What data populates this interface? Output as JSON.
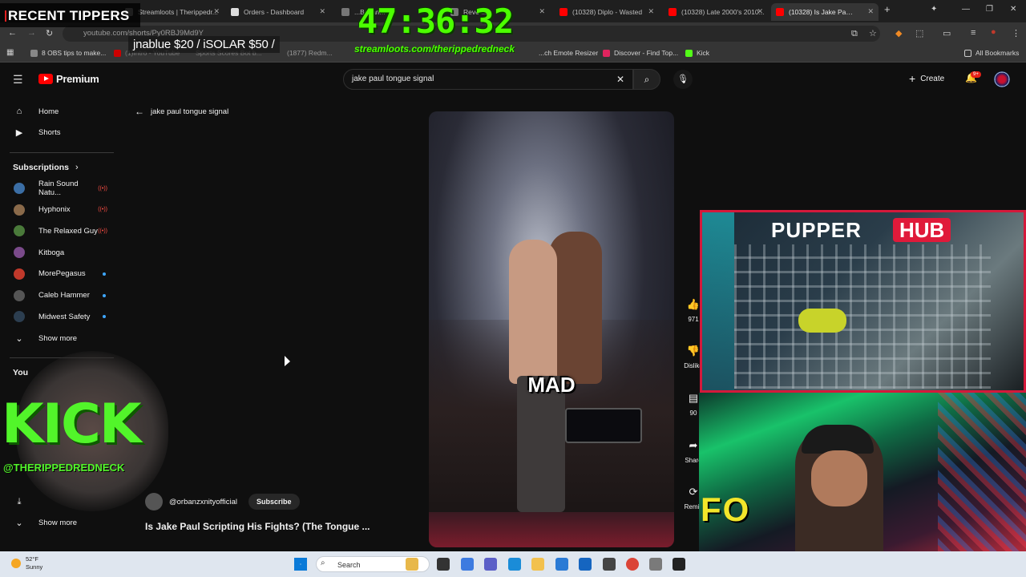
{
  "browser": {
    "tabs": [
      {
        "title": "Streamloots | Therippedr..."
      },
      {
        "title": "Orders - Dashboard"
      },
      {
        "title": "...Bot an..."
      },
      {
        "title": "Reven..."
      },
      {
        "title": "(10328) Diplo - Wasted"
      },
      {
        "title": "(10328) Late 2000's 2010..."
      },
      {
        "title": "(10328) Is Jake Paul S..."
      }
    ],
    "url": "youtube.com/shorts/Py0RBJ9Md9Y",
    "bookmarks": [
      {
        "label": "8 OBS tips to make..."
      },
      {
        "label": "(1)Intro - YouTube"
      },
      {
        "label": "Sports Scores Bot b..."
      },
      {
        "label": "(1877) Redm..."
      },
      {
        "label": "...ch Emote Resizer"
      },
      {
        "label": "Discover - Find Top..."
      },
      {
        "label": "Kick"
      },
      {
        "label": "All Bookmarks"
      }
    ]
  },
  "youtube": {
    "logo": "Premium",
    "search_value": "jake paul tongue signal",
    "create_label": "Create",
    "notif_badge": "9+",
    "back_label": "jake paul tongue signal",
    "sidebar": {
      "main": [
        {
          "label": "Home",
          "icon": "home-icon"
        },
        {
          "label": "Shorts",
          "icon": "shorts-icon"
        }
      ],
      "subscriptions_title": "Subscriptions",
      "subscriptions": [
        {
          "label": "Rain Sound Natu...",
          "status": "live",
          "color": "#3b6ea5"
        },
        {
          "label": "Hyphonix",
          "status": "live",
          "color": "#8a6a4a"
        },
        {
          "label": "The Relaxed Guy",
          "status": "live",
          "color": "#4a7a3a"
        },
        {
          "label": "Kitboga",
          "status": "",
          "color": "#7a4a8a"
        },
        {
          "label": "MorePegasus",
          "status": "new",
          "color": "#c0392b"
        },
        {
          "label": "Caleb Hammer",
          "status": "new",
          "color": "#555555"
        },
        {
          "label": "Midwest Safety",
          "status": "new",
          "color": "#2c3e50"
        }
      ],
      "show_more": "Show more",
      "you_title": "You",
      "show_more_2": "Show more"
    },
    "video": {
      "caption": "MAD",
      "channel": "@orbanzxnityofficial",
      "subscribe_label": "Subscribe",
      "title": "Is Jake Paul Scripting His Fights? (The Tongue ..."
    },
    "actions": [
      {
        "icon": "like-icon",
        "label": "971"
      },
      {
        "icon": "dislike-icon",
        "label": "Dislike"
      },
      {
        "icon": "comment-icon",
        "label": "90"
      },
      {
        "icon": "share-icon",
        "label": "Share"
      },
      {
        "icon": "remix-icon",
        "label": "Remix"
      }
    ]
  },
  "overlay": {
    "recent_tippers": "RECENT TIPPERS",
    "tip_line": "jnablue $20 / iSOLAR $50 /",
    "timer": "47:36:32",
    "streamloots": "streamloots.com/therippedredneck",
    "kick": "KICK",
    "kick_handle": "@THERIPPEDREDNECK",
    "pupper": "PUPPER",
    "hub": "HUB",
    "foto_text": "FO"
  },
  "taskbar": {
    "temp": "52°F",
    "condition": "Sunny",
    "search_label": "Search"
  },
  "colors": {
    "accent_green": "#4cff00",
    "youtube_red": "#ff0000",
    "pupper_red": "#e01a3a"
  }
}
